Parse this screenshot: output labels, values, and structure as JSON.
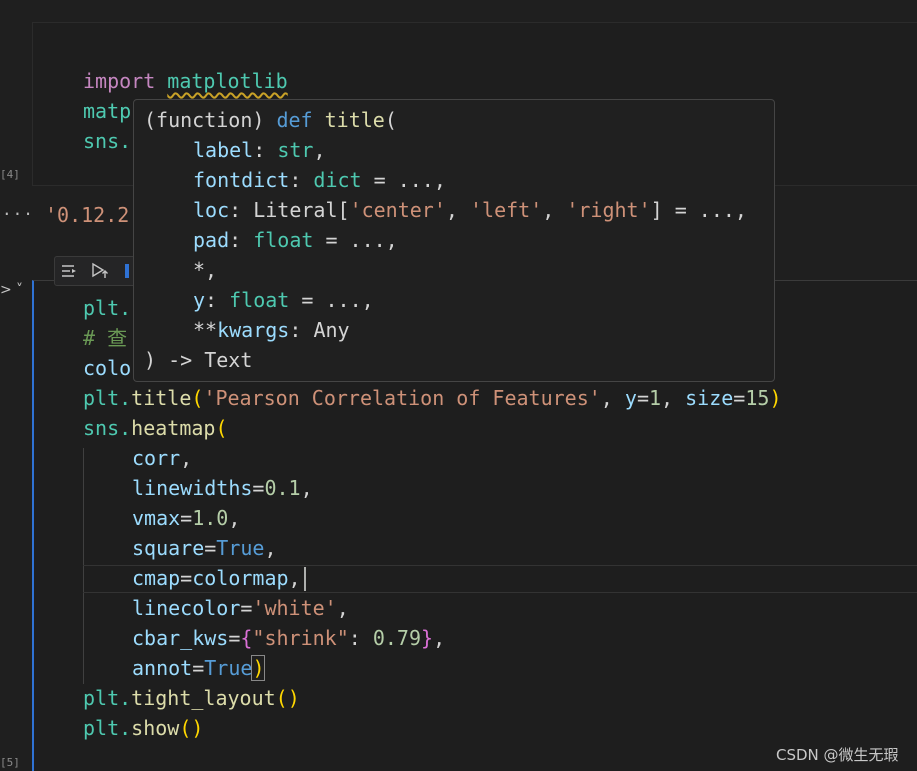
{
  "cell1": {
    "exec_count": "[4]",
    "line1": {
      "kw": "import",
      "mod": "matplotlib"
    },
    "line2_prefix": "matp",
    "line3_prefix": "sns."
  },
  "output": {
    "dots": "...",
    "text": "'0.12.2"
  },
  "toolbar": {
    "items": [
      "run-by-line-icon",
      "execute-above-icon",
      "more-icon"
    ]
  },
  "cell2": {
    "exec_count": "[5]",
    "l1": "plt.",
    "l2": "# 查",
    "l3": "colo",
    "title_line": {
      "obj": "plt.",
      "fn": "title",
      "str": "'Pearson Correlation of Features'",
      "y": "y",
      "y_val": "1",
      "size": "size",
      "size_val": "15"
    },
    "heatmap": {
      "obj": "sns.",
      "fn": "heatmap"
    },
    "args": {
      "corr": "corr",
      "linewidths": "linewidths",
      "linewidths_val": "0.1",
      "vmax": "vmax",
      "vmax_val": "1.0",
      "square": "square",
      "square_val": "True",
      "cmap": "cmap",
      "cmap_val": "colormap",
      "linecolor": "linecolor",
      "linecolor_val": "'white'",
      "cbar_kws": "cbar_kws",
      "cbar_key": "\"shrink\"",
      "cbar_val": "0.79",
      "annot": "annot",
      "annot_val": "True"
    },
    "tight": {
      "obj": "plt.",
      "fn": "tight_layout"
    },
    "show": {
      "obj": "plt.",
      "fn": "show"
    }
  },
  "hover": {
    "head_prefix": "(function)",
    "head_def": "def",
    "head_name": "title",
    "label_name": "label",
    "label_type": "str",
    "fontdict_name": "fontdict",
    "fontdict_type": "dict",
    "loc_name": "loc",
    "loc_type": "Literal",
    "loc_v1": "'center'",
    "loc_v2": "'left'",
    "loc_v3": "'right'",
    "pad_name": "pad",
    "pad_type": "float",
    "star": "*,",
    "y_name": "y",
    "y_type": "float",
    "kwargs_name": "kwargs",
    "kwargs_type": "Any",
    "ret": ") -> Text"
  },
  "watermark": "CSDN @微生无瑕"
}
